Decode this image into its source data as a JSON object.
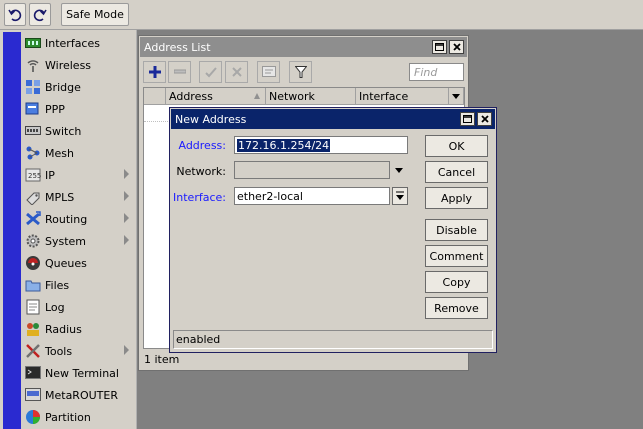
{
  "toolbar": {
    "undo_icon": "undo-icon",
    "redo_icon": "redo-icon",
    "safe_mode_label": "Safe Mode"
  },
  "sidebar": {
    "items": [
      {
        "label": "Interfaces",
        "icon": "interfaces-icon",
        "submenu": false
      },
      {
        "label": "Wireless",
        "icon": "wireless-icon",
        "submenu": false
      },
      {
        "label": "Bridge",
        "icon": "bridge-icon",
        "submenu": false
      },
      {
        "label": "PPP",
        "icon": "ppp-icon",
        "submenu": false
      },
      {
        "label": "Switch",
        "icon": "switch-icon",
        "submenu": false
      },
      {
        "label": "Mesh",
        "icon": "mesh-icon",
        "submenu": false
      },
      {
        "label": "IP",
        "icon": "ip-icon",
        "submenu": true
      },
      {
        "label": "MPLS",
        "icon": "mpls-icon",
        "submenu": true
      },
      {
        "label": "Routing",
        "icon": "routing-icon",
        "submenu": true
      },
      {
        "label": "System",
        "icon": "system-icon",
        "submenu": true
      },
      {
        "label": "Queues",
        "icon": "queues-icon",
        "submenu": false
      },
      {
        "label": "Files",
        "icon": "files-icon",
        "submenu": false
      },
      {
        "label": "Log",
        "icon": "log-icon",
        "submenu": false
      },
      {
        "label": "Radius",
        "icon": "radius-icon",
        "submenu": false
      },
      {
        "label": "Tools",
        "icon": "tools-icon",
        "submenu": true
      },
      {
        "label": "New Terminal",
        "icon": "terminal-icon",
        "submenu": false
      },
      {
        "label": "MetaROUTER",
        "icon": "metarouter-icon",
        "submenu": false
      },
      {
        "label": "Partition",
        "icon": "partition-icon",
        "submenu": false
      }
    ]
  },
  "address_list": {
    "title": "Address List",
    "find_placeholder": "Find",
    "columns": [
      "Address",
      "Network",
      "Interface"
    ],
    "status": "1 item"
  },
  "new_address": {
    "title": "New Address",
    "address_label": "Address:",
    "address_value": "172.16.1.254/24",
    "network_label": "Network:",
    "network_value": "",
    "interface_label": "Interface:",
    "interface_value": "ether2-local",
    "buttons": {
      "ok": "OK",
      "cancel": "Cancel",
      "apply": "Apply",
      "disable": "Disable",
      "comment": "Comment",
      "copy": "Copy",
      "remove": "Remove"
    },
    "status": "enabled"
  },
  "colors": {
    "active_title": "#0a246a",
    "inactive_title": "#8e8e8e",
    "label_blue": "#1a1aff",
    "sidebar_strip": "#2a2ad0"
  }
}
